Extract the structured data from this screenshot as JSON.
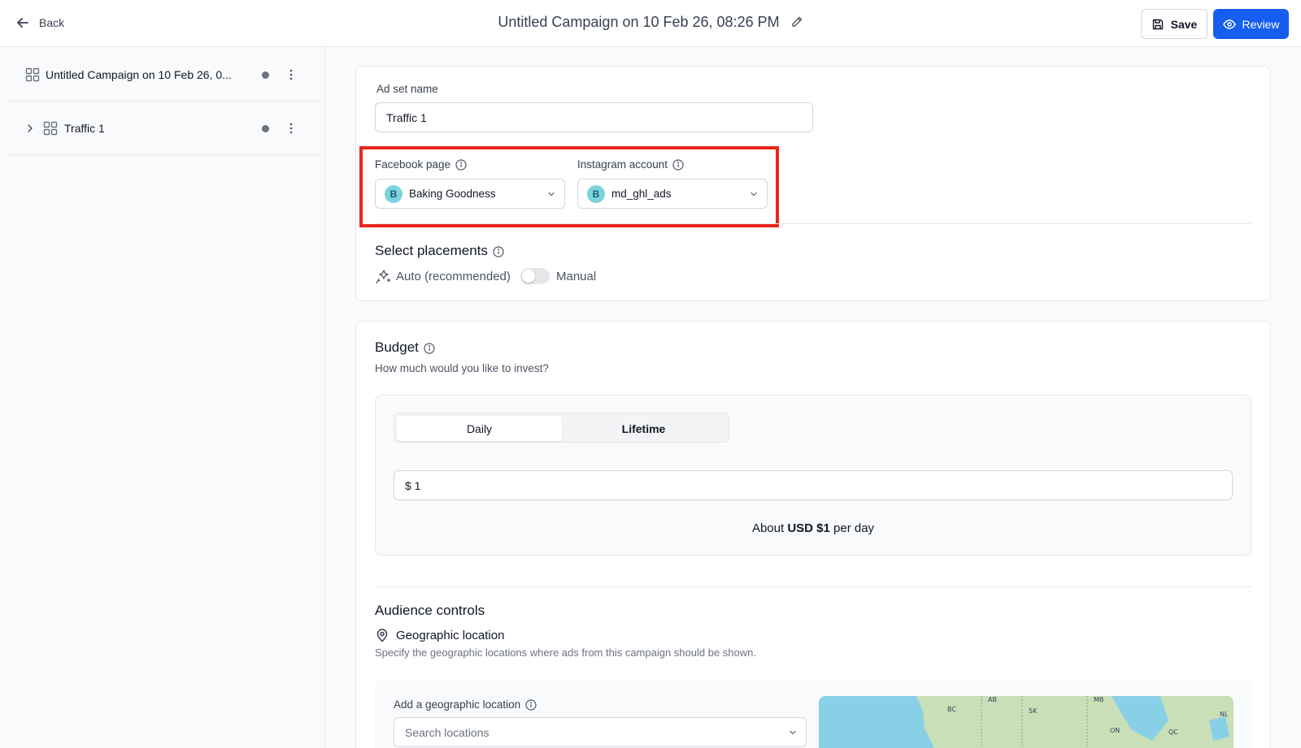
{
  "header": {
    "back_label": "Back",
    "title": "Untitled Campaign on 10 Feb 26, 08:26 PM",
    "save_label": "Save",
    "review_label": "Review",
    "accent_color": "#155eef"
  },
  "sidebar": {
    "items": [
      {
        "label": "Untitled Campaign on 10 Feb 26, 0...",
        "icon": "grid-icon"
      },
      {
        "label": "Traffic 1",
        "icon": "grid-icon",
        "expandable": true
      }
    ]
  },
  "adset": {
    "name_label": "Ad set name",
    "name_value": "Traffic 1",
    "facebook_label": "Facebook page",
    "facebook_avatar": "B",
    "facebook_value": "Baking Goodness",
    "instagram_label": "Instagram account",
    "instagram_avatar": "B",
    "instagram_value": "md_ghl_ads",
    "highlight_color": "#e8261c"
  },
  "placements": {
    "title": "Select placements",
    "auto_label": "Auto (recommended)",
    "manual_label": "Manual",
    "manual_enabled": false
  },
  "budget": {
    "title": "Budget",
    "subtitle": "How much would you like to invest?",
    "tabs": [
      "Daily",
      "Lifetime"
    ],
    "selected_tab": "Daily",
    "amount": "$ 1",
    "summary_prefix": "About ",
    "summary_amount": "USD $1",
    "summary_suffix": " per day"
  },
  "audience": {
    "title": "Audience controls",
    "geo_title": "Geographic location",
    "geo_desc": "Specify the geographic locations where ads from this campaign should be shown.",
    "add_label": "Add a geographic location",
    "search_placeholder": "Search locations",
    "map_labels": [
      "BC",
      "AB",
      "MB",
      "SK",
      "ON",
      "QC",
      "NL"
    ]
  }
}
